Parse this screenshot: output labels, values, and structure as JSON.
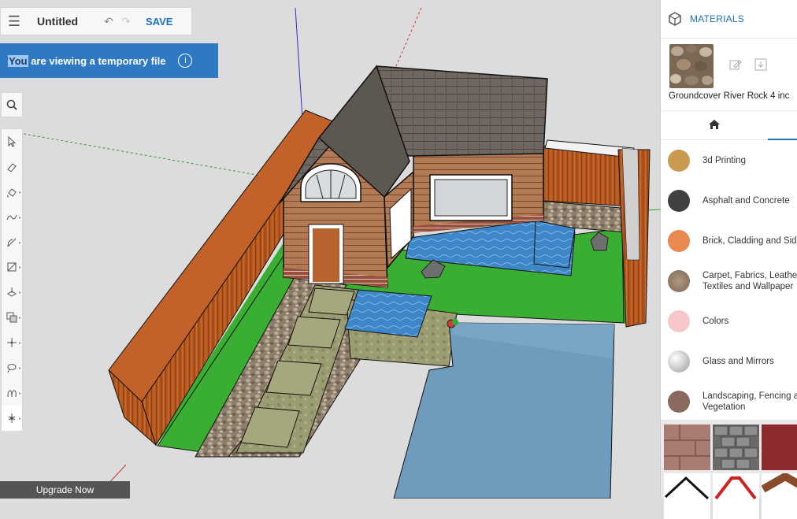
{
  "toolbar": {
    "title": "Untitled",
    "save_label": "SAVE",
    "undo_icon": "undo-icon",
    "redo_icon": "redo-icon",
    "menu_icon": "hamburger-icon"
  },
  "banner": {
    "highlight": "You",
    "rest": " are viewing a temporary file",
    "info_icon": "info-icon"
  },
  "tools": [
    "select-icon",
    "eraser-icon",
    "paint-bucket-icon",
    "freehand-icon",
    "arc-icon",
    "rectangle-icon",
    "push-pull-icon",
    "offset-icon",
    "move-icon",
    "rotate-icon",
    "tape-measure-icon",
    "orbit-icon"
  ],
  "upgrade_label": "Upgrade Now",
  "materials": {
    "title": "MATERIALS",
    "selected_name": "Groundcover River Rock 4 inc",
    "categories": [
      {
        "label": "3d Printing",
        "color": "#c99a4f"
      },
      {
        "label": "Asphalt and Concrete",
        "color": "#404040"
      },
      {
        "label": "Brick, Cladding and Sid",
        "color": "#e8894f"
      },
      {
        "label": "Carpet, Fabrics, Leathe\nTextiles and Wallpaper",
        "color": "#9c8772"
      },
      {
        "label": "Colors",
        "color": "#f6c8cc"
      },
      {
        "label": "Glass and Mirrors",
        "color": "#c9c9c9"
      },
      {
        "label": "Landscaping, Fencing a\nVegetation",
        "color": "#8a6a5e"
      }
    ]
  },
  "colors": {
    "accent": "#1e73be",
    "banner": "#2f78c2"
  }
}
